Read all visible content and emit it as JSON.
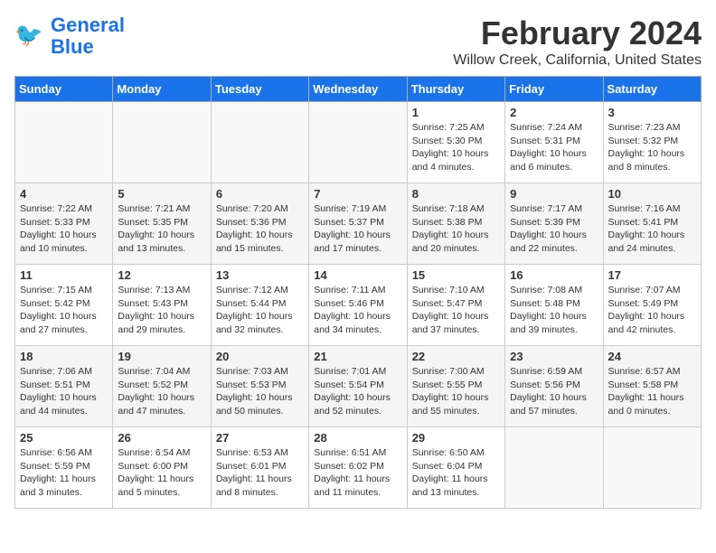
{
  "logo": {
    "line1": "General",
    "line2": "Blue"
  },
  "title": "February 2024",
  "subtitle": "Willow Creek, California, United States",
  "weekdays": [
    "Sunday",
    "Monday",
    "Tuesday",
    "Wednesday",
    "Thursday",
    "Friday",
    "Saturday"
  ],
  "weeks": [
    [
      {
        "num": "",
        "info": ""
      },
      {
        "num": "",
        "info": ""
      },
      {
        "num": "",
        "info": ""
      },
      {
        "num": "",
        "info": ""
      },
      {
        "num": "1",
        "info": "Sunrise: 7:25 AM\nSunset: 5:30 PM\nDaylight: 10 hours\nand 4 minutes."
      },
      {
        "num": "2",
        "info": "Sunrise: 7:24 AM\nSunset: 5:31 PM\nDaylight: 10 hours\nand 6 minutes."
      },
      {
        "num": "3",
        "info": "Sunrise: 7:23 AM\nSunset: 5:32 PM\nDaylight: 10 hours\nand 8 minutes."
      }
    ],
    [
      {
        "num": "4",
        "info": "Sunrise: 7:22 AM\nSunset: 5:33 PM\nDaylight: 10 hours\nand 10 minutes."
      },
      {
        "num": "5",
        "info": "Sunrise: 7:21 AM\nSunset: 5:35 PM\nDaylight: 10 hours\nand 13 minutes."
      },
      {
        "num": "6",
        "info": "Sunrise: 7:20 AM\nSunset: 5:36 PM\nDaylight: 10 hours\nand 15 minutes."
      },
      {
        "num": "7",
        "info": "Sunrise: 7:19 AM\nSunset: 5:37 PM\nDaylight: 10 hours\nand 17 minutes."
      },
      {
        "num": "8",
        "info": "Sunrise: 7:18 AM\nSunset: 5:38 PM\nDaylight: 10 hours\nand 20 minutes."
      },
      {
        "num": "9",
        "info": "Sunrise: 7:17 AM\nSunset: 5:39 PM\nDaylight: 10 hours\nand 22 minutes."
      },
      {
        "num": "10",
        "info": "Sunrise: 7:16 AM\nSunset: 5:41 PM\nDaylight: 10 hours\nand 24 minutes."
      }
    ],
    [
      {
        "num": "11",
        "info": "Sunrise: 7:15 AM\nSunset: 5:42 PM\nDaylight: 10 hours\nand 27 minutes."
      },
      {
        "num": "12",
        "info": "Sunrise: 7:13 AM\nSunset: 5:43 PM\nDaylight: 10 hours\nand 29 minutes."
      },
      {
        "num": "13",
        "info": "Sunrise: 7:12 AM\nSunset: 5:44 PM\nDaylight: 10 hours\nand 32 minutes."
      },
      {
        "num": "14",
        "info": "Sunrise: 7:11 AM\nSunset: 5:46 PM\nDaylight: 10 hours\nand 34 minutes."
      },
      {
        "num": "15",
        "info": "Sunrise: 7:10 AM\nSunset: 5:47 PM\nDaylight: 10 hours\nand 37 minutes."
      },
      {
        "num": "16",
        "info": "Sunrise: 7:08 AM\nSunset: 5:48 PM\nDaylight: 10 hours\nand 39 minutes."
      },
      {
        "num": "17",
        "info": "Sunrise: 7:07 AM\nSunset: 5:49 PM\nDaylight: 10 hours\nand 42 minutes."
      }
    ],
    [
      {
        "num": "18",
        "info": "Sunrise: 7:06 AM\nSunset: 5:51 PM\nDaylight: 10 hours\nand 44 minutes."
      },
      {
        "num": "19",
        "info": "Sunrise: 7:04 AM\nSunset: 5:52 PM\nDaylight: 10 hours\nand 47 minutes."
      },
      {
        "num": "20",
        "info": "Sunrise: 7:03 AM\nSunset: 5:53 PM\nDaylight: 10 hours\nand 50 minutes."
      },
      {
        "num": "21",
        "info": "Sunrise: 7:01 AM\nSunset: 5:54 PM\nDaylight: 10 hours\nand 52 minutes."
      },
      {
        "num": "22",
        "info": "Sunrise: 7:00 AM\nSunset: 5:55 PM\nDaylight: 10 hours\nand 55 minutes."
      },
      {
        "num": "23",
        "info": "Sunrise: 6:59 AM\nSunset: 5:56 PM\nDaylight: 10 hours\nand 57 minutes."
      },
      {
        "num": "24",
        "info": "Sunrise: 6:57 AM\nSunset: 5:58 PM\nDaylight: 11 hours\nand 0 minutes."
      }
    ],
    [
      {
        "num": "25",
        "info": "Sunrise: 6:56 AM\nSunset: 5:59 PM\nDaylight: 11 hours\nand 3 minutes."
      },
      {
        "num": "26",
        "info": "Sunrise: 6:54 AM\nSunset: 6:00 PM\nDaylight: 11 hours\nand 5 minutes."
      },
      {
        "num": "27",
        "info": "Sunrise: 6:53 AM\nSunset: 6:01 PM\nDaylight: 11 hours\nand 8 minutes."
      },
      {
        "num": "28",
        "info": "Sunrise: 6:51 AM\nSunset: 6:02 PM\nDaylight: 11 hours\nand 11 minutes."
      },
      {
        "num": "29",
        "info": "Sunrise: 6:50 AM\nSunset: 6:04 PM\nDaylight: 11 hours\nand 13 minutes."
      },
      {
        "num": "",
        "info": ""
      },
      {
        "num": "",
        "info": ""
      }
    ]
  ]
}
